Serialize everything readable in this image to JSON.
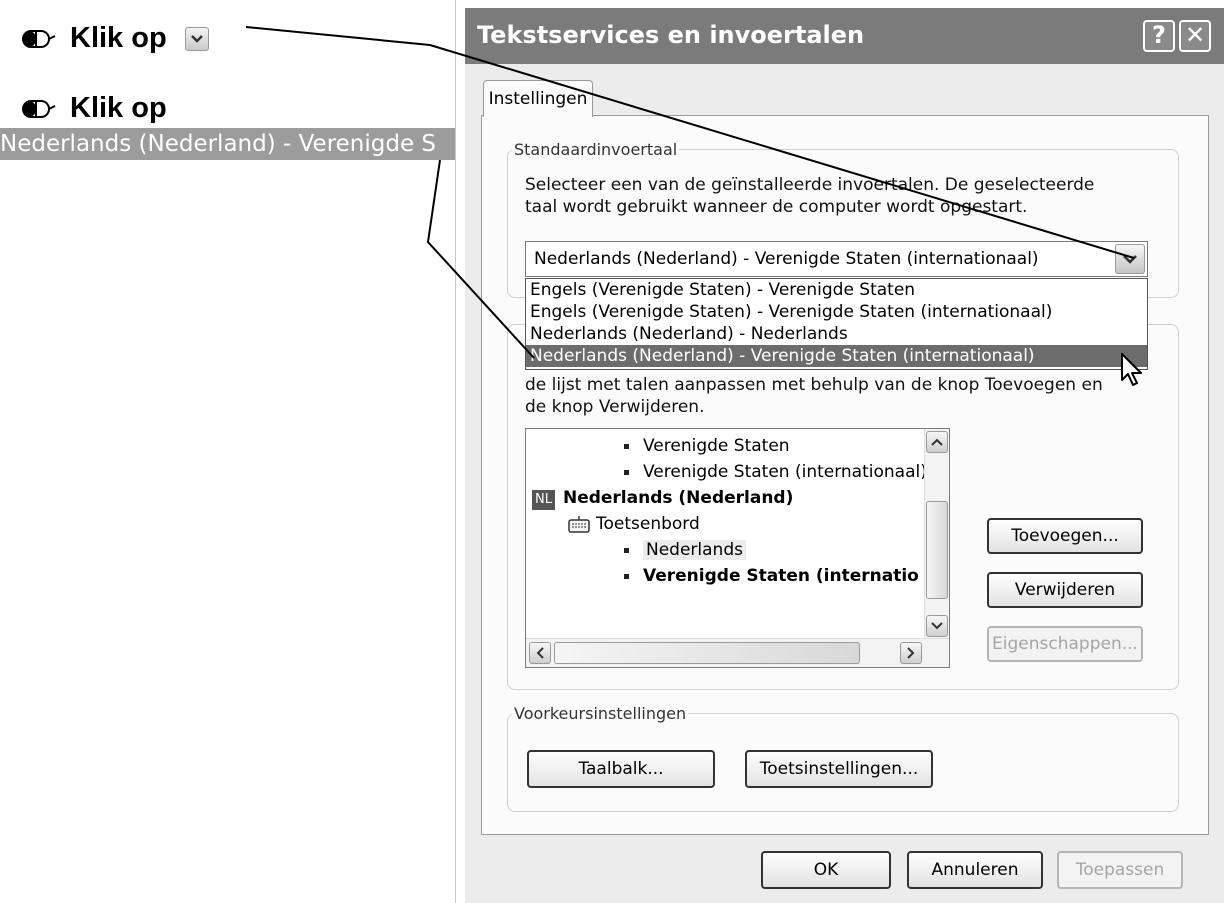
{
  "instructions": {
    "step1_text": "Klik op",
    "step2_text": "Klik op",
    "step2_target": "Nederlands (Nederland) - Verenigde S"
  },
  "dialog": {
    "title": "Tekstservices en invoertalen",
    "help_label": "?",
    "close_label": "✕",
    "tab_label": "Instellingen",
    "default_lang": {
      "legend": "Standaardinvoertaal",
      "desc_line1": "Selecteer een van de geïnstalleerde invoertalen. De geselecteerde",
      "desc_line2": "taal wordt gebruikt wanneer de computer wordt opgestart.",
      "selected": "Nederlands (Nederland) - Verenigde Staten (internationaal)",
      "options": [
        "Engels (Verenigde Staten) - Verenigde Staten",
        "Engels (Verenigde Staten) - Verenigde Staten (internationaal)",
        "Nederlands (Nederland) - Nederlands",
        "Nederlands (Nederland) - Verenigde Staten (internationaal)"
      ]
    },
    "installed": {
      "desc_line1": "de lijst met talen aanpassen met behulp van de knop Toevoegen en",
      "desc_line2": "de knop Verwijderen.",
      "tree": {
        "item1": "Verenigde Staten",
        "item2": "Verenigde Staten (internationaal)",
        "lang_badge": "NL",
        "lang": "Nederlands (Nederland)",
        "keyboard": "Toetsenbord",
        "kb1": "Nederlands",
        "kb2": "Verenigde Staten (internatio"
      },
      "add_button": "Toevoegen...",
      "remove_button": "Verwijderen",
      "properties_button": "Eigenschappen..."
    },
    "prefs": {
      "legend": "Voorkeursinstellingen",
      "languagebar_button": "Taalbalk...",
      "keysettings_button": "Toetsinstellingen..."
    },
    "footer": {
      "ok": "OK",
      "cancel": "Annuleren",
      "apply": "Toepassen"
    }
  },
  "colors": {
    "titlebar": "#7b7b7b",
    "selection": "#6c6c6c",
    "highlight_target": "#9c9c9c"
  },
  "icons": [
    "mouse-icon",
    "chevron-down-icon",
    "help-icon",
    "close-icon",
    "keyboard-icon",
    "cursor-arrow-icon"
  ]
}
